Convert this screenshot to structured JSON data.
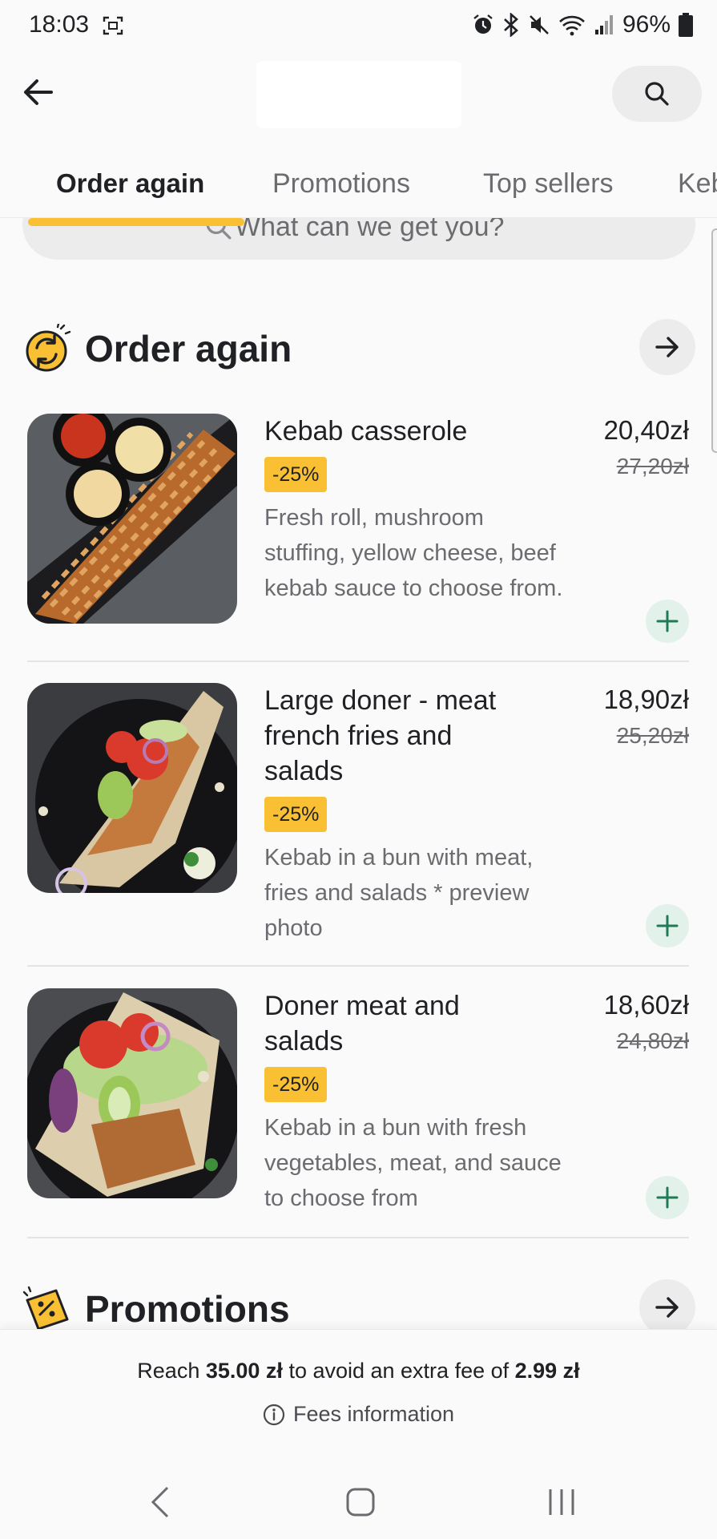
{
  "status_bar": {
    "time": "18:03",
    "battery": "96%",
    "icons": [
      "screenshot-icon",
      "alarm-icon",
      "bluetooth-icon",
      "mute-icon",
      "wifi-icon",
      "signal-icon",
      "battery-icon"
    ]
  },
  "header": {
    "back_icon": "arrow-left-icon",
    "search_icon": "search-icon"
  },
  "tabs": [
    {
      "label": "Order again",
      "active": true
    },
    {
      "label": "Promotions",
      "active": false
    },
    {
      "label": "Top sellers",
      "active": false
    },
    {
      "label": "Keb",
      "active": false
    }
  ],
  "search": {
    "placeholder": "What can we get you?"
  },
  "sections": {
    "order_again": {
      "title": "Order again",
      "items": [
        {
          "name": "Kebab casserole",
          "badge": "-25%",
          "description": "Fresh roll, mushroom stuffing, yellow cheese, beef kebab sauce to choose from.",
          "price": "20,40zł",
          "old_price": "27,20zł"
        },
        {
          "name": "Large doner - meat french fries and salads",
          "badge": "-25%",
          "description": "Kebab in a bun with meat, fries and salads * preview photo",
          "price": "18,90zł",
          "old_price": "25,20zł"
        },
        {
          "name": "Doner meat and salads",
          "badge": "-25%",
          "description": "Kebab in a bun with fresh vegetables, meat, and sauce to choose from",
          "price": "18,60zł",
          "old_price": "24,80zł"
        }
      ]
    },
    "promotions": {
      "title": "Promotions"
    }
  },
  "footer": {
    "fee_prefix": "Reach ",
    "fee_threshold": "35.00 zł",
    "fee_middle": " to avoid an extra fee of ",
    "fee_amount": "2.99 zł",
    "fees_info_label": "Fees information"
  },
  "colors": {
    "accent_yellow": "#f9c034",
    "plus_button_bg": "#e2f1ea",
    "plus_icon": "#1f7a55",
    "text_primary": "#202125",
    "text_secondary": "#6b6b70"
  }
}
